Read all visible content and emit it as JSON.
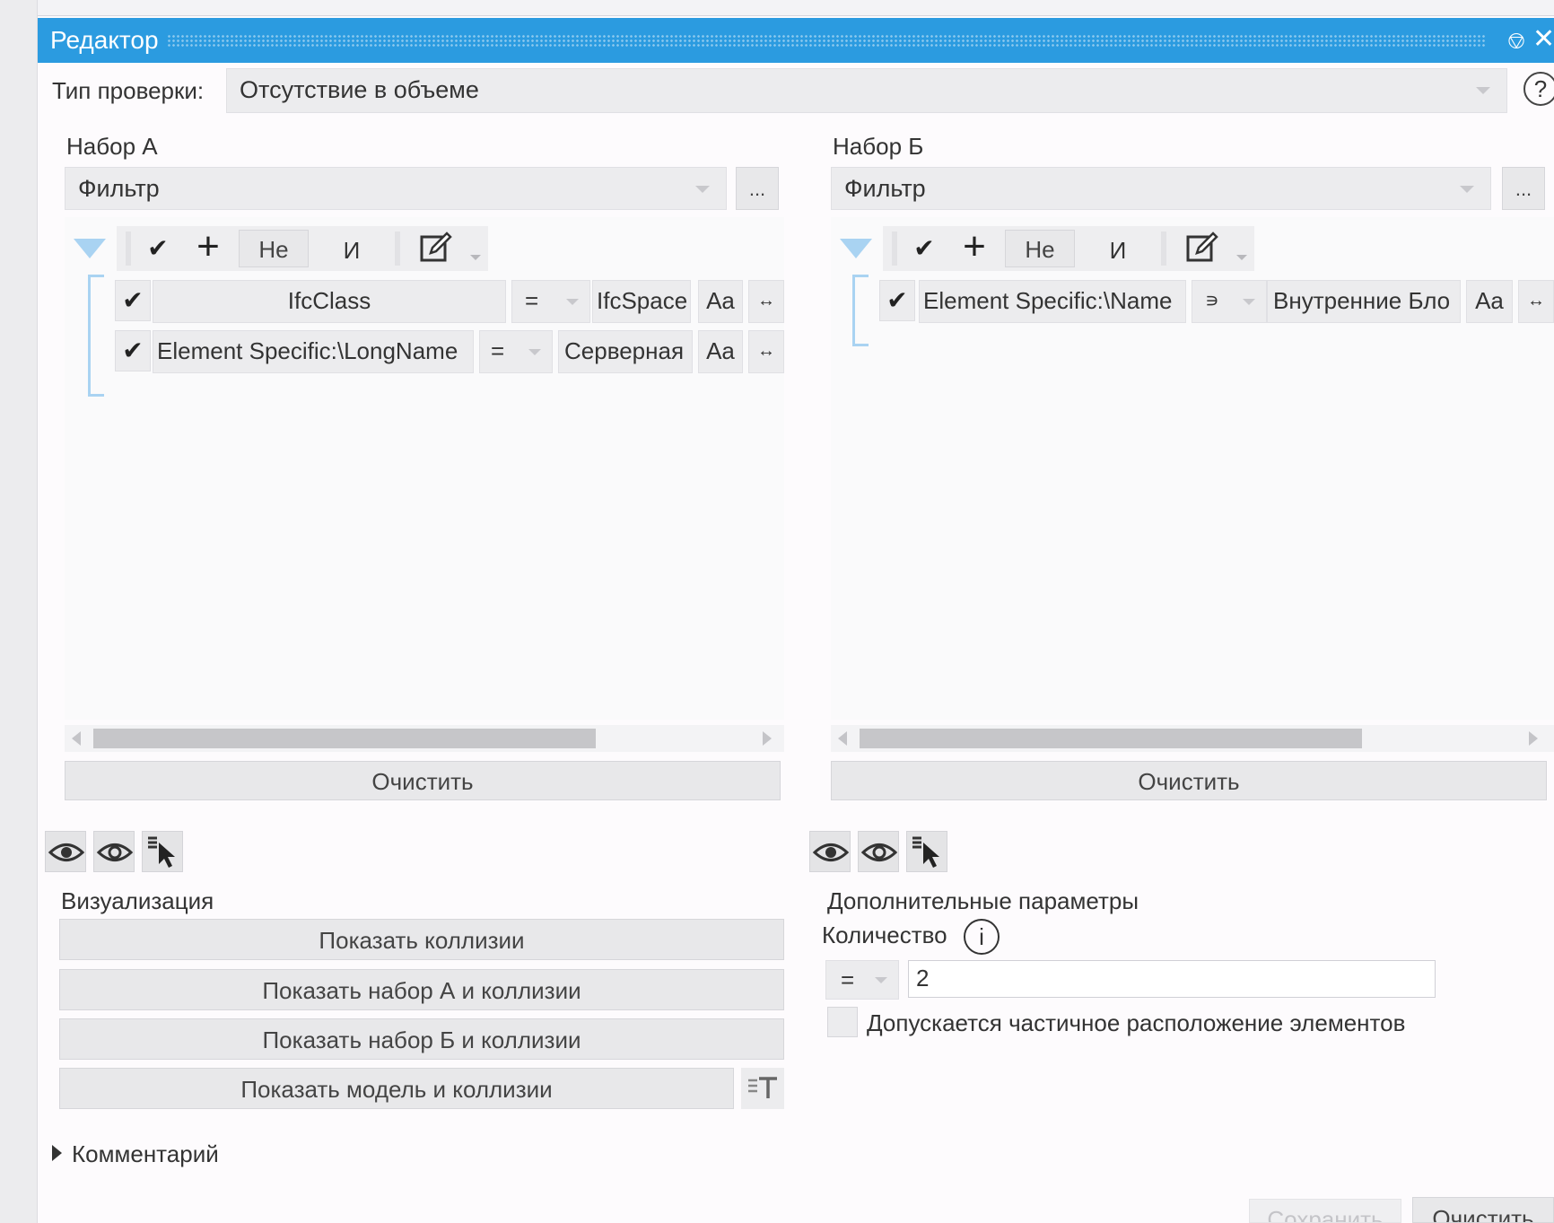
{
  "window": {
    "title": "Редактор"
  },
  "check_type": {
    "label": "Тип проверки:",
    "value": "Отсутствие в объеме"
  },
  "set_a": {
    "title": "Набор А",
    "source": "Фильтр",
    "more_label": "...",
    "toolbar": {
      "not_label": "Не",
      "and_label": "И"
    },
    "rows": [
      {
        "field": "IfcClass",
        "operator": "=",
        "value": "IfcSpace",
        "case_label": "Aa",
        "link_label": "↔"
      },
      {
        "field": "Element Specific:\\LongName",
        "operator": "=",
        "value": "Серверная",
        "case_label": "Aa",
        "link_label": "↔"
      }
    ],
    "clear_label": "Очистить"
  },
  "set_b": {
    "title": "Набор Б",
    "source": "Фильтр",
    "more_label": "...",
    "toolbar": {
      "not_label": "Не",
      "and_label": "И"
    },
    "rows": [
      {
        "field": "Element Specific:\\Name",
        "operator": "∍",
        "value": "Внутренние Бло",
        "case_label": "Aa",
        "link_label": "↔"
      }
    ],
    "clear_label": "Очистить"
  },
  "visualization": {
    "title": "Визуализация",
    "buttons": [
      "Показать коллизии",
      "Показать набор А и коллизии",
      "Показать набор Б и коллизии",
      "Показать модель и коллизии"
    ]
  },
  "extra_params": {
    "title": "Дополнительные параметры",
    "count_label": "Количество",
    "count_operator": "=",
    "count_value": "2",
    "partial_label": "Допускается частичное расположение элементов"
  },
  "comment": {
    "label": "Комментарий"
  },
  "footer": {
    "save_label": "Сохранить",
    "clear_label": "Очистить"
  },
  "colors": {
    "titlebar": "#2b9be0",
    "bracket": "#a9d3f2"
  }
}
